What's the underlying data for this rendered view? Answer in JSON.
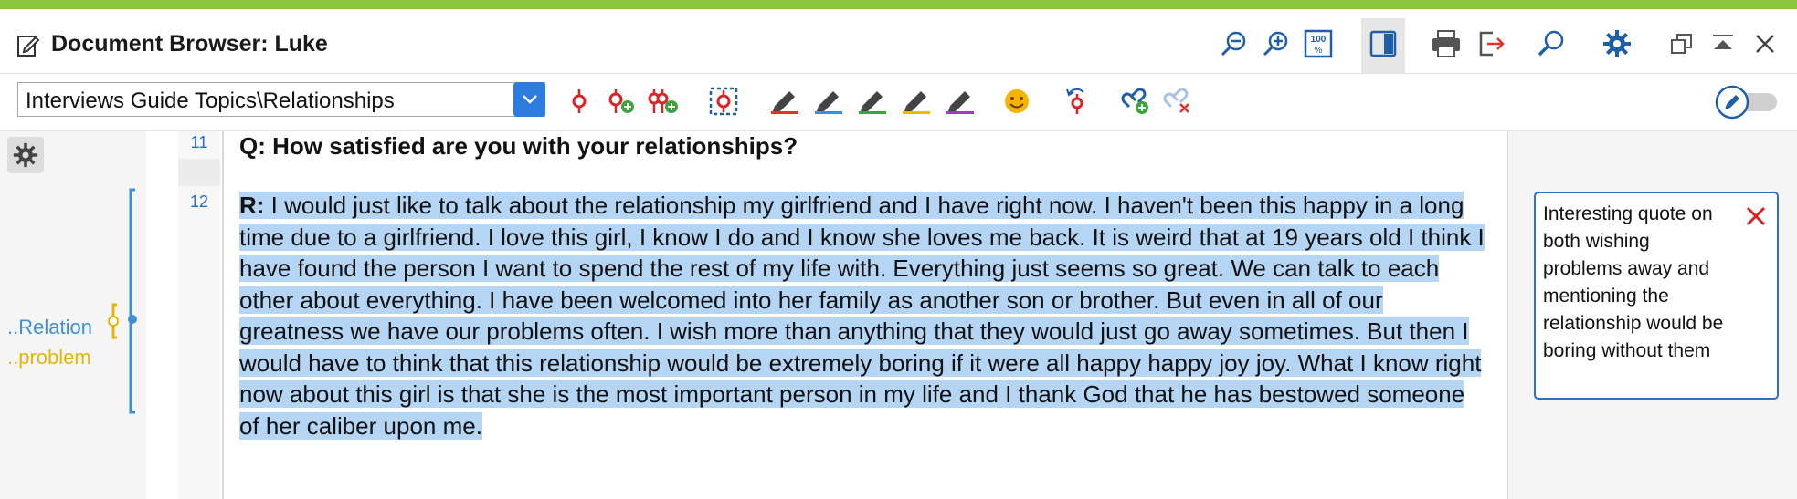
{
  "window": {
    "title": "Document Browser: Luke"
  },
  "titlebar_icons": [
    "zoom-out-icon",
    "zoom-in-icon",
    "zoom-100-icon",
    "panel-icon",
    "print-icon",
    "export-icon",
    "search-icon",
    "gear-icon",
    "restore-icon",
    "minimize-icon",
    "close-icon"
  ],
  "toolbar": {
    "code_select_value": "Interviews Guide Topics\\Relationships",
    "tools": [
      "code-icon",
      "code-new-icon",
      "code-multiple-icon",
      "code-selection-icon",
      "highlight-red-icon",
      "highlight-blue-icon",
      "highlight-green-icon",
      "highlight-yellow-icon",
      "highlight-purple-icon",
      "emoticon-icon",
      "undo-code-icon",
      "link-add-icon",
      "link-remove-icon"
    ],
    "edit_mode_toggle": false
  },
  "codes": [
    {
      "label": "..Relation",
      "color": "#3d8fd6"
    },
    {
      "label": "..problem",
      "color": "#e6b800"
    }
  ],
  "document": {
    "paragraphs": [
      {
        "number": "11",
        "text": "Q: How satisfied are you with your relationships?"
      },
      {
        "number": "12",
        "speaker": "R:",
        "text": " I would just like to talk about the relationship my girlfriend and I have right now. I haven't been this happy in a long time due to a girlfriend. I love this girl, I know I do and I know she loves me back. It is weird that at 19 years old I think I have found the person I want to spend the rest of my life with. Everything just seems so great. We can talk to each other about everything. I have been welcomed into her family as another son or brother. But even in all of our greatness we have our problems often. I wish more than anything that they would just go away sometimes. But then I would have to think that this relationship would be extremely boring if it were all happy happy joy joy. What I know right now about this girl is that she is the most important person in my life and I thank God that he has bestowed someone of her caliber upon me."
      }
    ]
  },
  "memo": {
    "text": "Interesting quote on both wishing problems away and mentioning the relationship would be boring without them"
  },
  "colors": {
    "accent_bar": "#8dc63f",
    "selection": "#b5d5f5",
    "memo_border": "#2e6fc8"
  }
}
